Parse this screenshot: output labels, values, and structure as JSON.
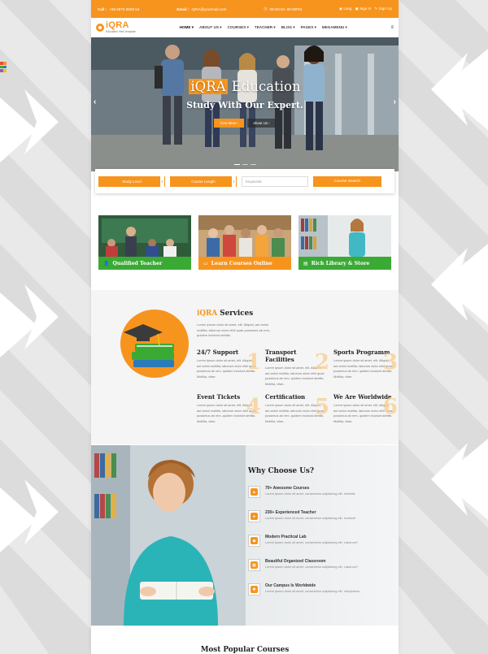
{
  "topbar": {
    "call_label": "Call :",
    "phone": "+98 5875 9868 54",
    "email_label": "Email :",
    "email": "iQRA@yourmail.com",
    "hours": "08:00AM- 09:00PM",
    "lang": "Lang",
    "signin": "Sign In",
    "signup": "Sign Up"
  },
  "logo": {
    "name": "iQRA",
    "tagline": "Education Html template"
  },
  "nav": {
    "items": [
      "HOME ▾",
      "ABOUT US ▾",
      "COURSES ▾",
      "TEACHER ▾",
      "BLOG ▾",
      "PAGES ▾",
      "MEGAMENU ▾"
    ],
    "toggle": "≡"
  },
  "hero": {
    "brand": "iQRA",
    "title_rest": " Education",
    "subtitle": "Study With Our Expert.",
    "btn_primary": "View More ›",
    "btn_secondary": "About Us ›"
  },
  "search": {
    "study_level": "Study Level",
    "course_length": "Course Length",
    "keywords_placeholder": "Keywords",
    "submit": "Course Search"
  },
  "features": [
    {
      "label": "Qualified Teacher",
      "icon": "user-icon"
    },
    {
      "label": "Learn Courses Online",
      "icon": "monitor-icon"
    },
    {
      "label": "Rich Library & Store",
      "icon": "book-icon"
    }
  ],
  "services": {
    "title_accent": "iQRA",
    "title_rest": " Services",
    "intro": "Lorem ipsum dolor sit amet, elit. Aliquid, aut animi mollitia, laborum dolor nihil quae possimus ab rem, quidem incidunt debitis.",
    "items": [
      {
        "title": "24/7 Support",
        "num": "1",
        "text": "Lorem ipsum dolor sit amet, elit. Aliquid, aut animi mollitia, laborum dolor nihil quae possimus ab rem, quidem incidunt debitis. Mollitia, vitae."
      },
      {
        "title": "Transport Facilities",
        "num": "2",
        "text": "Lorem ipsum dolor sit amet, elit. Aliquid, aut animi mollitia, laborum dolor nihil quae possimus ab rem, quidem incidunt debitis. Mollitia, vitae."
      },
      {
        "title": "Sports Programm",
        "num": "3",
        "text": "Lorem ipsum dolor sit amet, elit. Aliquid, aut animi mollitia, laborum dolor nihil quae possimus ab rem, quidem incidunt debitis. Mollitia, vitae."
      },
      {
        "title": "Event Tickets",
        "num": "4",
        "text": "Lorem ipsum dolor sit amet, elit. Aliquid, aut animi mollitia, laborum dolor nihil quae possimus ab rem, quidem incidunt debitis. Mollitia, vitae."
      },
      {
        "title": "Certification",
        "num": "5",
        "text": "Lorem ipsum dolor sit amet, elit. Aliquid, aut animi mollitia, laborum dolor nihil quae possimus ab rem, quidem incidunt debitis. Mollitia, vitae."
      },
      {
        "title": "We Are Worldwide",
        "num": "6",
        "text": "Lorem ipsum dolor sit amet, elit. Aliquid, aut animi mollitia, laborum dolor nihil quae possimus ab rem, quidem incidunt debitis. Mollitia, vitae."
      }
    ]
  },
  "why": {
    "title": "Why Choose Us?",
    "items": [
      {
        "title": "70+ Awesome Courses",
        "text": "Lorem ipsum dolor sit amet, consectetur adipisicing elit. Veritatis."
      },
      {
        "title": "230+ Experienced Teacher",
        "text": "Lorem ipsum dolor sit amet, consectetur adipisicing elit. Incidunt!"
      },
      {
        "title": "Modern Practical Lab",
        "text": "Lorem ipsum dolor sit amet, consectetur adipisicing elit. Laborum?"
      },
      {
        "title": "Beautiful Organized Classroom",
        "text": "Lorem ipsum dolor sit amet, consectetur adipisicing elit. Laborum?"
      },
      {
        "title": "Our Campus Is Worldwide",
        "text": "Lorem ipsum dolor sit amet, consectetur adipisicing elit. Voluptatum."
      }
    ]
  },
  "popular": {
    "title": "Most Popular Courses"
  },
  "colors": {
    "accent": "#f7941d",
    "green": "#3aaa35"
  }
}
